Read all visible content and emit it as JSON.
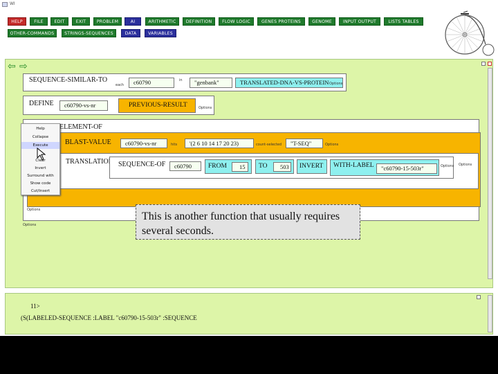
{
  "window": {
    "title": "WI"
  },
  "menu": {
    "row1": [
      {
        "label": "HELP",
        "color": "red"
      },
      {
        "label": "FILE",
        "color": "green"
      },
      {
        "label": "EDIT",
        "color": "green"
      },
      {
        "label": "EXIT",
        "color": "green"
      },
      {
        "label": "PROBLEM",
        "color": "green"
      },
      {
        "label": "AI",
        "color": "blue"
      },
      {
        "label": "ARITHMETIC",
        "color": "green"
      },
      {
        "label": "DEFINITION",
        "color": "green"
      },
      {
        "label": "FLOW LOGIC",
        "color": "green"
      },
      {
        "label": "GENES PROTEINS",
        "color": "green"
      },
      {
        "label": "GENOME",
        "color": "green"
      },
      {
        "label": "INPUT OUTPUT",
        "color": "green"
      },
      {
        "label": "LISTS TABLES",
        "color": "green"
      }
    ],
    "row2": [
      {
        "label": "OTHER-COMMANDS",
        "color": "green"
      },
      {
        "label": "STRINGS-SEQUENCES",
        "color": "green"
      },
      {
        "label": "DATA",
        "color": "blue"
      },
      {
        "label": "VARIABLES",
        "color": "blue"
      }
    ]
  },
  "editor": {
    "seq_similar": {
      "keyword": "SEQUENCE-SIMILAR-TO",
      "each_label": "each",
      "arg1": "c60790",
      "in_label": "in",
      "arg2": "\"genbank\"",
      "arg3": "TRANSLATED-DNA-VS-PROTEIN",
      "options": "Options"
    },
    "define": {
      "keyword": "DEFINE",
      "name": "c60790-vs-nr",
      "value": "PREVIOUS-RESULT",
      "options": "Options"
    },
    "outer": {
      "keyword": "ELEMENT-OF",
      "options_1": "Options",
      "options_2": "Options"
    },
    "blast": {
      "keyword": "BLAST-VALUE",
      "arg1": "c60790-vs-nr",
      "arg1_suffix": "hits",
      "list": "'(2 6 10 14 17 20 23)",
      "count_label": "count-selected",
      "tseq": "\"T-SEQ\"",
      "options": "Options"
    },
    "translation": {
      "keyword": "TRANSLATION-OF",
      "options": "Options",
      "seq_of": {
        "keyword": "SEQUENCE-OF",
        "arg": "c60790",
        "from_label": "FROM",
        "from_val": "15",
        "to_label": "TO",
        "to_val": "503",
        "invert": "INVERT",
        "with_label_kw": "WITH-LABEL",
        "label_val": "\"c60790-15-503r\"",
        "options": "Options"
      }
    },
    "popup_menu": [
      "Help",
      "Collapse",
      "Execute",
      "Clear",
      "Invert",
      "Surround with",
      "Show code",
      "Cut/Insert"
    ],
    "tooltip": "This is another function that usually requires several seconds."
  },
  "output": {
    "line1": "11>",
    "line2": "(S(LABELED-SEQUENCE :LABEL \"c60790-15-503r\" :SEQUENCE"
  },
  "colors": {
    "menu_green": "#1f7a2c",
    "menu_red": "#c42a2a",
    "menu_blue": "#2b2f9c",
    "editor_bg": "#ddf5a8",
    "block_orange": "#f7b400",
    "block_cyan": "#8ef0ef"
  }
}
